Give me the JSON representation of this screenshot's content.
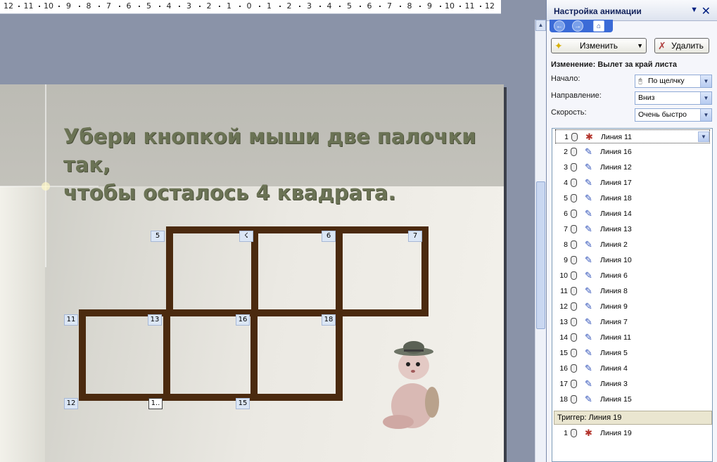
{
  "ruler": {
    "numbers": [
      "12",
      "11",
      "10",
      "9",
      "8",
      "7",
      "6",
      "5",
      "4",
      "3",
      "2",
      "1",
      "0",
      "1",
      "2",
      "3",
      "4",
      "5",
      "6",
      "7",
      "8",
      "9",
      "10",
      "11",
      "12"
    ]
  },
  "slide": {
    "title_line1": "Убери кнопкой мыши две палочки так,",
    "title_line2": "чтобы осталось 4 квадрата.",
    "stick_color": "#4b2a0f",
    "markers": [
      "5",
      "6",
      "7",
      "11",
      "13",
      "16",
      "18",
      "12",
      "1..",
      "15"
    ]
  },
  "pane": {
    "title": "Настройка анимации",
    "close_glyph": "✕",
    "dropdown_glyph": "▼",
    "change_button": "Изменить",
    "delete_button": "Удалить",
    "change_title": "Изменение: Вылет за край листа",
    "start_label": "Начало:",
    "start_value": "По щелчку",
    "direction_label": "Направление:",
    "direction_value": "Вниз",
    "speed_label": "Скорость:",
    "speed_value": "Очень быстро",
    "items": [
      {
        "n": "1",
        "label": "Линия 11"
      },
      {
        "n": "2",
        "label": "Линия 16"
      },
      {
        "n": "3",
        "label": "Линия 12"
      },
      {
        "n": "4",
        "label": "Линия 17"
      },
      {
        "n": "5",
        "label": "Линия 18"
      },
      {
        "n": "6",
        "label": "Линия 14"
      },
      {
        "n": "7",
        "label": "Линия 13"
      },
      {
        "n": "8",
        "label": "Линия 2"
      },
      {
        "n": "9",
        "label": "Линия 10"
      },
      {
        "n": "10",
        "label": "Линия 6"
      },
      {
        "n": "11",
        "label": "Линия 8"
      },
      {
        "n": "12",
        "label": "Линия 9"
      },
      {
        "n": "13",
        "label": "Линия 7"
      },
      {
        "n": "14",
        "label": "Линия 11"
      },
      {
        "n": "15",
        "label": "Линия 5"
      },
      {
        "n": "16",
        "label": "Линия 4"
      },
      {
        "n": "17",
        "label": "Линия 3"
      },
      {
        "n": "18",
        "label": "Линия 15"
      }
    ],
    "trigger": "Триггер: Линия 19",
    "trigger_item": {
      "n": "1",
      "label": "Линия 19"
    }
  }
}
